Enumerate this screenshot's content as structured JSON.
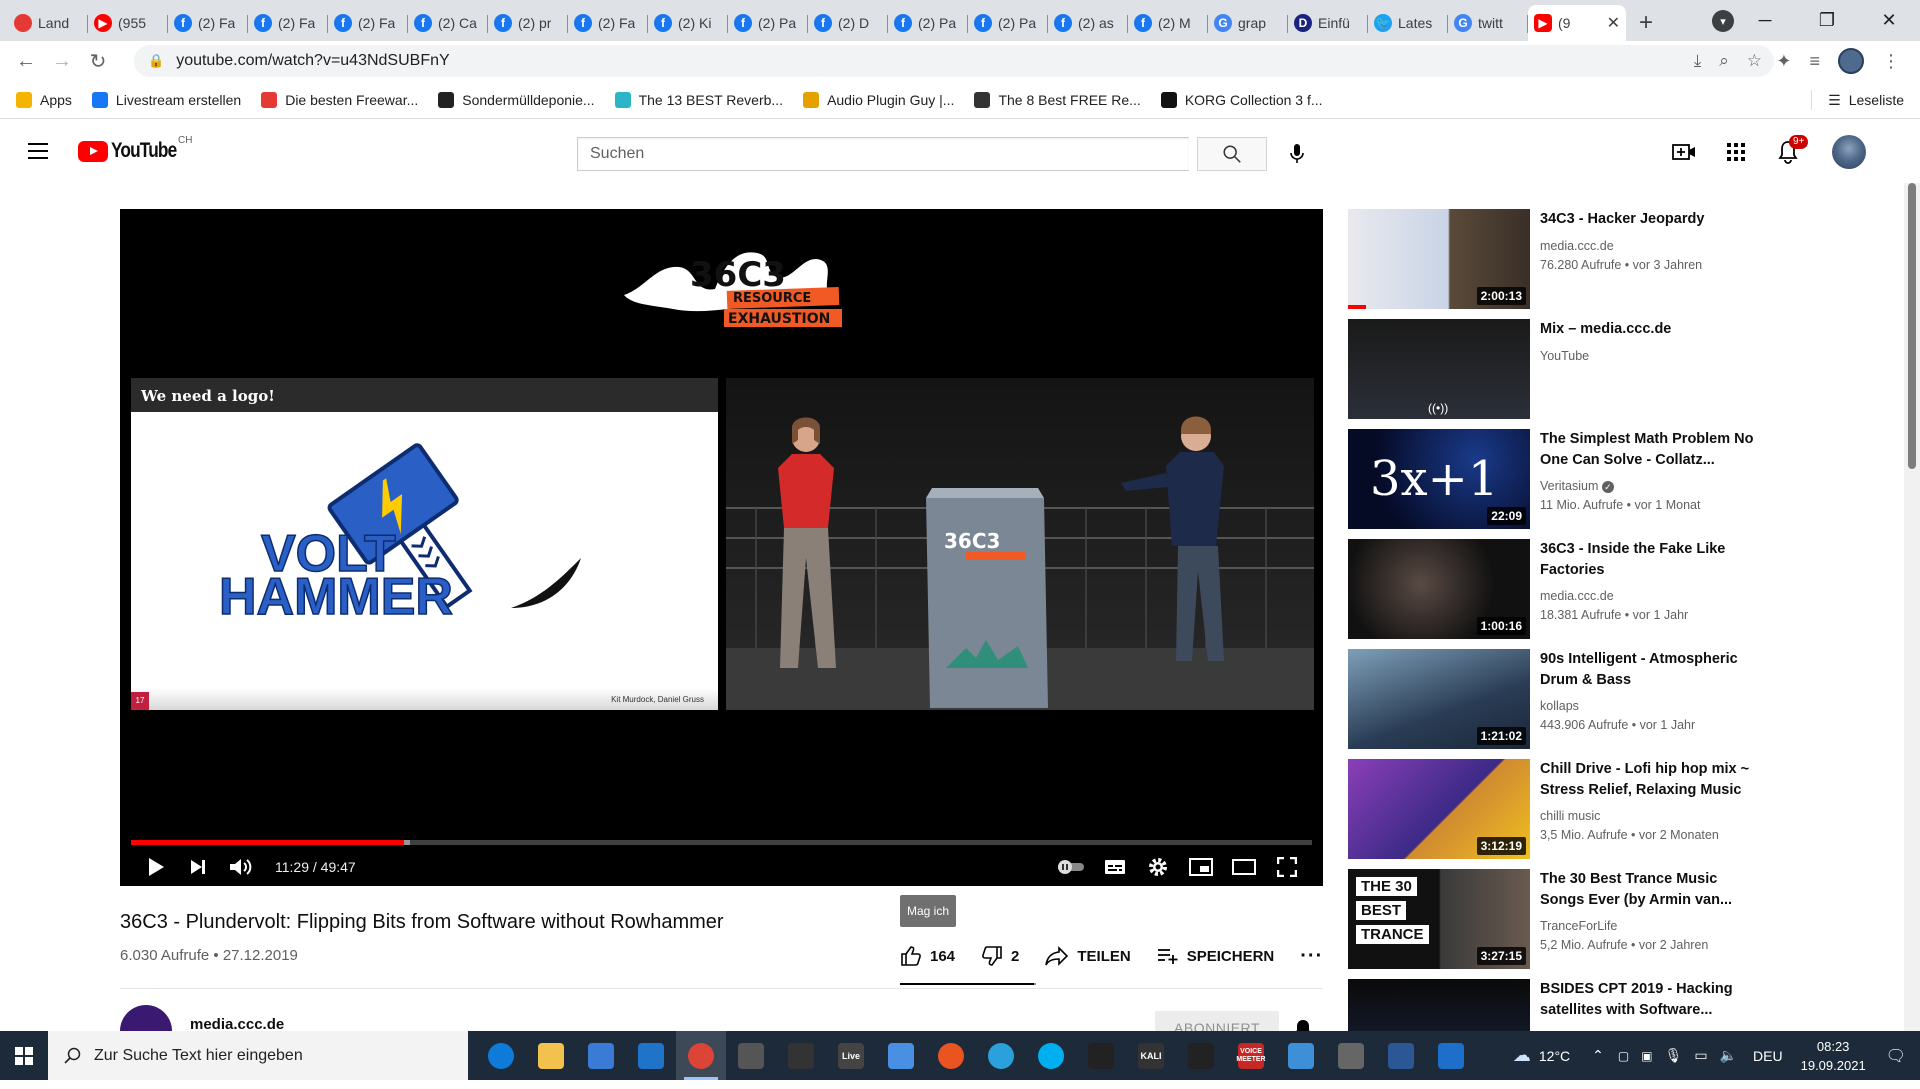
{
  "browser": {
    "tabs": [
      {
        "title": "Land",
        "color": "#e53935",
        "glyph": ""
      },
      {
        "title": "(955",
        "color": "#ff0000",
        "glyph": "▶"
      },
      {
        "title": "(2) Fa",
        "color": "#1877f2",
        "glyph": "f"
      },
      {
        "title": "(2) Fa",
        "color": "#1877f2",
        "glyph": "f"
      },
      {
        "title": "(2) Fa",
        "color": "#1877f2",
        "glyph": "f"
      },
      {
        "title": "(2) Ca",
        "color": "#1877f2",
        "glyph": "f"
      },
      {
        "title": "(2) pr",
        "color": "#1877f2",
        "glyph": "f"
      },
      {
        "title": "(2) Fa",
        "color": "#1877f2",
        "glyph": "f"
      },
      {
        "title": "(2) Ki",
        "color": "#1877f2",
        "glyph": "f"
      },
      {
        "title": "(2) Pa",
        "color": "#1877f2",
        "glyph": "f"
      },
      {
        "title": "(2) D",
        "color": "#1877f2",
        "glyph": "f"
      },
      {
        "title": "(2) Pa",
        "color": "#1877f2",
        "glyph": "f"
      },
      {
        "title": "(2) Pa",
        "color": "#1877f2",
        "glyph": "f"
      },
      {
        "title": "(2) as",
        "color": "#1877f2",
        "glyph": "f"
      },
      {
        "title": "(2) M",
        "color": "#1877f2",
        "glyph": "f"
      },
      {
        "title": "grap",
        "color": "#4285f4",
        "glyph": "G"
      },
      {
        "title": "Einfü",
        "color": "#1a237e",
        "glyph": "D"
      },
      {
        "title": "Lates",
        "color": "#1da1f2",
        "glyph": "🐦"
      },
      {
        "title": "twitt",
        "color": "#4285f4",
        "glyph": "G"
      }
    ],
    "active_tab": {
      "title": "(9",
      "color": "#ff0000",
      "glyph": "▶"
    },
    "url": "youtube.com/watch?v=u43NdSUBFnY",
    "bookmarks": [
      {
        "label": "Apps",
        "color": "#f4b400"
      },
      {
        "label": "Livestream erstellen",
        "color": "#1877f2"
      },
      {
        "label": "Die besten Freewar...",
        "color": "#e53935"
      },
      {
        "label": "Sondermülldeponie...",
        "color": "#222222"
      },
      {
        "label": "The 13 BEST Reverb...",
        "color": "#2bb5c8"
      },
      {
        "label": "Audio Plugin Guy |...",
        "color": "#e6a100"
      },
      {
        "label": "The 8 Best FREE Re...",
        "color": "#333333"
      },
      {
        "label": "KORG Collection 3 f...",
        "color": "#111111"
      }
    ],
    "reading_list": "Leseliste"
  },
  "youtube": {
    "country": "CH",
    "search_placeholder": "Suchen",
    "notification_count": "9+"
  },
  "player": {
    "slide_title": "We need a logo!",
    "slide_page": "17",
    "slide_authors": "Kit Murdock, Daniel Gruss",
    "logo_text1": "VOLT",
    "logo_text2": "HAMMER",
    "time": "11:29 / 49:47",
    "progress_played": 0.231,
    "progress_buffered": 0.236
  },
  "video": {
    "title": "36C3 - Plundervolt: Flipping Bits from Software without Rowhammer",
    "meta": "6.030 Aufrufe • 27.12.2019",
    "tooltip": "Mag ich",
    "likes": "164",
    "dislikes": "2",
    "share_label": "TEILEN",
    "save_label": "SPEICHERN",
    "channel": "media.ccc.de",
    "subscribe_label": "ABONNIERT",
    "like_ratio": 0.988
  },
  "recommendations": [
    {
      "title": "34C3 - Hacker Jeopardy",
      "channel": "media.ccc.de",
      "meta": "76.280 Aufrufe • vor 3 Jahren",
      "duration": "2:00:13",
      "verified": false
    },
    {
      "title": "Mix – media.ccc.de",
      "channel": "YouTube",
      "meta": "",
      "duration": "",
      "verified": false
    },
    {
      "title": "The Simplest Math Problem No One Can Solve - Collatz...",
      "channel": "Veritasium",
      "meta": "11 Mio. Aufrufe • vor 1 Monat",
      "duration": "22:09",
      "verified": true,
      "thumb_text": "3x+1"
    },
    {
      "title": "36C3 - Inside the Fake Like Factories",
      "channel": "media.ccc.de",
      "meta": "18.381 Aufrufe • vor 1 Jahr",
      "duration": "1:00:16",
      "verified": false
    },
    {
      "title": "90s Intelligent - Atmospheric Drum & Bass",
      "channel": "kollaps",
      "meta": "443.906 Aufrufe • vor 1 Jahr",
      "duration": "1:21:02",
      "verified": false
    },
    {
      "title": "Chill Drive - Lofi hip hop mix ~ Stress Relief, Relaxing Music",
      "channel": "chilli music",
      "meta": "3,5 Mio. Aufrufe • vor 2 Monaten",
      "duration": "3:12:19",
      "verified": false
    },
    {
      "title": "The 30 Best Trance Music Songs Ever (by Armin van...",
      "channel": "TranceForLife",
      "meta": "5,2 Mio. Aufrufe • vor 2 Jahren",
      "duration": "3:27:15",
      "verified": false,
      "thumb_lines": [
        "THE 30",
        "BEST",
        "TRANCE"
      ]
    },
    {
      "title": "BSIDES CPT 2019 - Hacking satellites with Software...",
      "channel": "",
      "meta": "",
      "duration": "",
      "verified": false
    }
  ],
  "taskbar": {
    "search_placeholder": "Zur Suche Text hier eingeben",
    "apps": [
      {
        "name": "edge",
        "color": "#0f7bd8"
      },
      {
        "name": "explorer",
        "color": "#f2c14e"
      },
      {
        "name": "store",
        "color": "#3a7bd5"
      },
      {
        "name": "mail",
        "color": "#1f73c9"
      },
      {
        "name": "chrome",
        "color": "#db4437"
      },
      {
        "name": "app6",
        "color": "#555555"
      },
      {
        "name": "app7",
        "color": "#333333"
      },
      {
        "name": "live",
        "color": "#444444"
      },
      {
        "name": "app9",
        "color": "#4a90e2"
      },
      {
        "name": "ubuntu",
        "color": "#e95420"
      },
      {
        "name": "telegram",
        "color": "#2aa1da"
      },
      {
        "name": "skype",
        "color": "#00aff0"
      },
      {
        "name": "app13",
        "color": "#222222"
      },
      {
        "name": "kali",
        "color": "#333333"
      },
      {
        "name": "app15",
        "color": "#222222"
      },
      {
        "name": "voicemeeter",
        "color": "#c62828"
      },
      {
        "name": "app17",
        "color": "#3d8fd8"
      },
      {
        "name": "app18",
        "color": "#666666"
      },
      {
        "name": "app19",
        "color": "#2b5797"
      },
      {
        "name": "app20",
        "color": "#1e6fc9"
      }
    ],
    "live_label": "Live",
    "kali_label": "KALI",
    "voice_label": "VOICE",
    "meeter_label": "MEETER",
    "temperature": "12°C",
    "language": "DEU",
    "time": "08:23",
    "date": "19.09.2021"
  }
}
